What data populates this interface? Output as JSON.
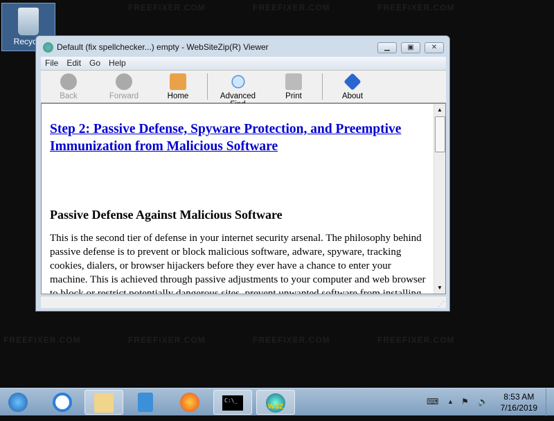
{
  "desktop": {
    "recycle_label": "Recycle",
    "watermark": "FREEFIXER.COM"
  },
  "window": {
    "title": "Default (fix spellchecker...) empty - WebSiteZip(R) Viewer",
    "menu": [
      "File",
      "Edit",
      "Go",
      "Help"
    ],
    "toolbar": {
      "back": "Back",
      "forward": "Forward",
      "home": "Home",
      "find": "Advanced Find",
      "print": "Print",
      "about": "About"
    },
    "content": {
      "heading_link": "Step 2: Passive Defense, Spyware Protection, and Preemptive Immunization from Malicious Software",
      "subheading": "Passive Defense Against Malicious Software",
      "paragraph": "This is the second tier of defense in your internet security arsenal. The philosophy behind passive defense is to prevent or block malicious software, adware, spyware, tracking cookies, dialers, or browser hijackers before they ever have a chance to enter your machine. This is achieved through passive adjustments to your computer and web browser to block or restrict potentially dangerous sites, prevent unwanted software from installing"
    }
  },
  "taskbar": {
    "time": "8:53 AM",
    "date": "7/16/2019",
    "cmd_label": "C:\\_",
    "wsz_label": "WSZ"
  }
}
